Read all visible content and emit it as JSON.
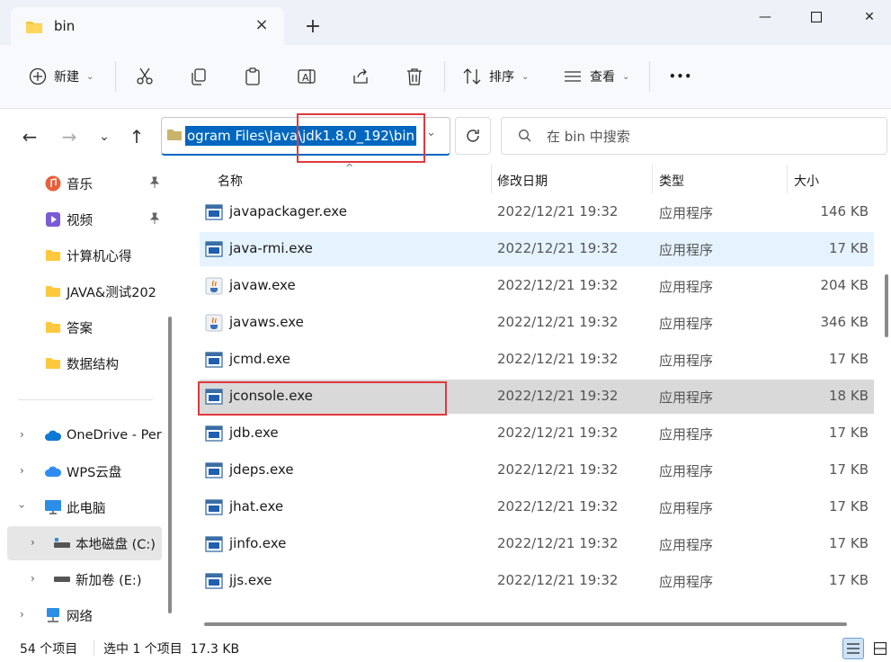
{
  "window": {
    "tab_title": "bin",
    "new_tab": "+",
    "minimize": "—",
    "close": "✕"
  },
  "toolbar": {
    "new_label": "新建",
    "sort_label": "排序",
    "view_label": "查看",
    "more": "•••"
  },
  "address": {
    "path": "ogram Files\\Java\\jdk1.8.0_192\\bin"
  },
  "search": {
    "placeholder": "在 bin 中搜索"
  },
  "sidebar": {
    "quick": [
      {
        "label": "音乐",
        "pinned": true
      },
      {
        "label": "视频",
        "pinned": true
      },
      {
        "label": "计算机心得"
      },
      {
        "label": "JAVA&测试202"
      },
      {
        "label": "答案"
      },
      {
        "label": "数据结构"
      }
    ],
    "tree": [
      {
        "label": "OneDrive - Per"
      },
      {
        "label": "WPS云盘"
      },
      {
        "label": "此电脑"
      },
      {
        "label": "本地磁盘 (C:)"
      },
      {
        "label": "新加卷 (E:)"
      },
      {
        "label": "网络"
      }
    ]
  },
  "list": {
    "headers": {
      "name": "名称",
      "date": "修改日期",
      "type": "类型",
      "size": "大小"
    },
    "rows": [
      {
        "name": "javapackager.exe",
        "date": "2022/12/21 19:32",
        "type": "应用程序",
        "size": "146 KB",
        "icon": "exe-window-icon"
      },
      {
        "name": "java-rmi.exe",
        "date": "2022/12/21 19:32",
        "type": "应用程序",
        "size": "17 KB",
        "icon": "exe-window-icon"
      },
      {
        "name": "javaw.exe",
        "date": "2022/12/21 19:32",
        "type": "应用程序",
        "size": "204 KB",
        "icon": "java-cup-icon"
      },
      {
        "name": "javaws.exe",
        "date": "2022/12/21 19:32",
        "type": "应用程序",
        "size": "346 KB",
        "icon": "java-cup-icon"
      },
      {
        "name": "jcmd.exe",
        "date": "2022/12/21 19:32",
        "type": "应用程序",
        "size": "17 KB",
        "icon": "exe-window-icon"
      },
      {
        "name": "jconsole.exe",
        "date": "2022/12/21 19:32",
        "type": "应用程序",
        "size": "18 KB",
        "icon": "exe-window-icon"
      },
      {
        "name": "jdb.exe",
        "date": "2022/12/21 19:32",
        "type": "应用程序",
        "size": "17 KB",
        "icon": "exe-window-icon"
      },
      {
        "name": "jdeps.exe",
        "date": "2022/12/21 19:32",
        "type": "应用程序",
        "size": "17 KB",
        "icon": "exe-window-icon"
      },
      {
        "name": "jhat.exe",
        "date": "2022/12/21 19:32",
        "type": "应用程序",
        "size": "17 KB",
        "icon": "exe-window-icon"
      },
      {
        "name": "jinfo.exe",
        "date": "2022/12/21 19:32",
        "type": "应用程序",
        "size": "17 KB",
        "icon": "exe-window-icon"
      },
      {
        "name": "jjs.exe",
        "date": "2022/12/21 19:32",
        "type": "应用程序",
        "size": "17 KB",
        "icon": "exe-window-icon"
      }
    ]
  },
  "status": {
    "count": "54 个项目",
    "selection": "选中 1 个项目  17.3 KB"
  },
  "colors": {
    "accent": "#0067c0",
    "highlight_box": "#e0393e",
    "selected_row": "#d9d9d9",
    "hover_row": "#e5f3ff"
  }
}
